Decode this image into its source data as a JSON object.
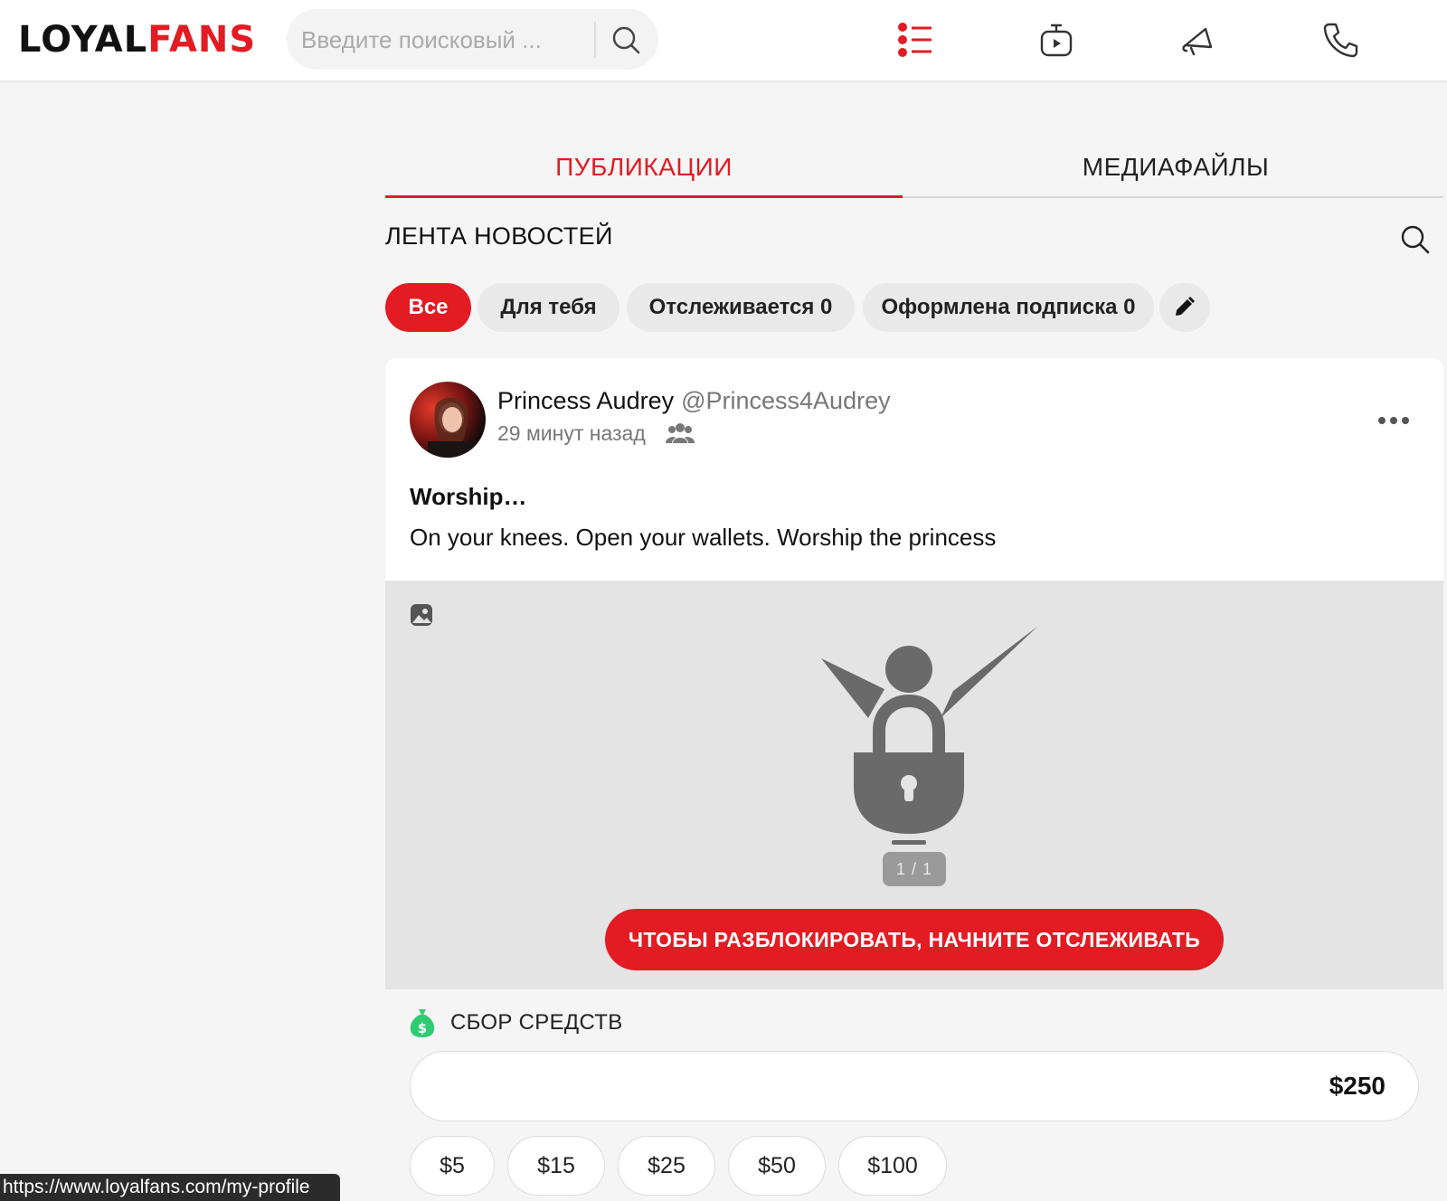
{
  "header": {
    "logo_part1": "LOYAL",
    "logo_part2": "FANS",
    "search_placeholder": "Введите поисковый ..."
  },
  "tabs": [
    {
      "label": "ПУБЛИКАЦИИ",
      "active": true
    },
    {
      "label": "МЕДИАФАЙЛЫ",
      "active": false
    }
  ],
  "feed": {
    "title": "ЛЕНТА НОВОСТЕЙ",
    "filters": [
      {
        "label": "Все",
        "active": true
      },
      {
        "label": "Для тебя",
        "active": false
      },
      {
        "label": "Отслеживается 0",
        "active": false
      },
      {
        "label": "Оформлена подписка 0",
        "active": false
      }
    ]
  },
  "post": {
    "author_name": "Princess Audrey",
    "author_handle": "@Princess4Audrey",
    "time": "29 минут назад",
    "title": "Worship…",
    "body": "On your knees. Open your wallets. Worship the princess",
    "media_counter": "1 / 1",
    "unlock_label": "ЧТОБЫ РАЗБЛОКИРОВАТЬ, НАЧНИТЕ ОТСЛЕЖИВАТЬ",
    "fundraiser": {
      "title": "СБОР СРЕДСТВ",
      "amount": "$250",
      "presets": [
        "$5",
        "$15",
        "$25",
        "$50",
        "$100"
      ]
    }
  },
  "status_url": "https://www.loyalfans.com/my-profile",
  "colors": {
    "accent": "#e31b23",
    "fund_green": "#2ecc71"
  }
}
